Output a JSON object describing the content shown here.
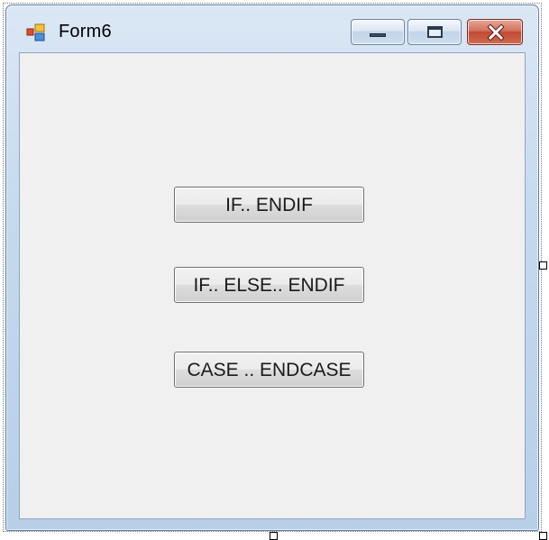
{
  "window": {
    "title": "Form6",
    "icon": "winforms-app-icon",
    "controls": {
      "minimize": "minimize-icon",
      "maximize": "maximize-icon",
      "close": "close-icon"
    }
  },
  "buttons": [
    {
      "label": "IF.. ENDIF"
    },
    {
      "label": "IF.. ELSE.. ENDIF"
    },
    {
      "label": "CASE .. ENDCASE"
    }
  ],
  "colors": {
    "client_background": "#f0f0f0",
    "frame_blue": "#c6d9ee",
    "close_red": "#c24a33"
  }
}
